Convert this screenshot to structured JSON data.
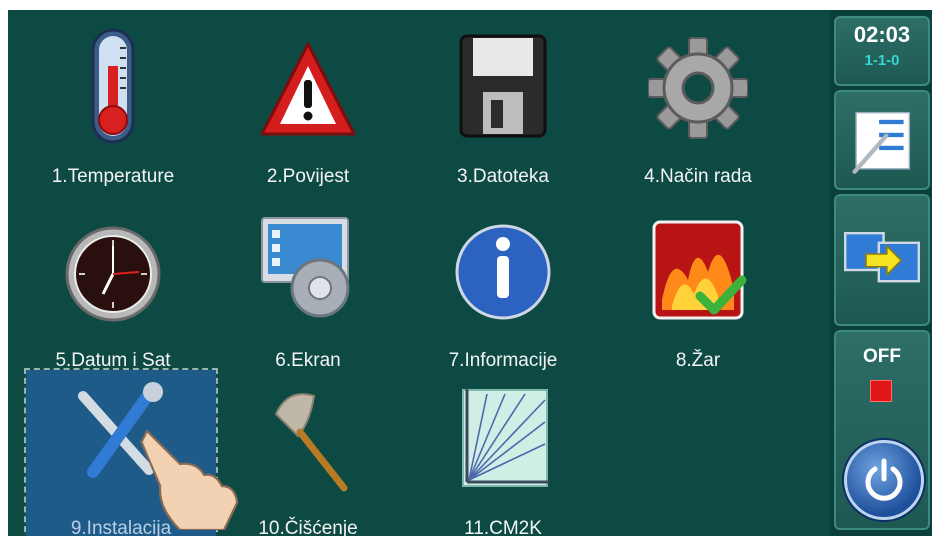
{
  "menu": {
    "items": [
      {
        "label": "1.Temperature",
        "icon": "thermometer-icon"
      },
      {
        "label": "2.Povijest",
        "icon": "warning-icon"
      },
      {
        "label": "3.Datoteka",
        "icon": "floppy-disk-icon"
      },
      {
        "label": "4.Način rada",
        "icon": "gear-icon"
      },
      {
        "label": "5.Datum i Sat",
        "icon": "clock-icon"
      },
      {
        "label": "6.Ekran",
        "icon": "monitor-gear-icon"
      },
      {
        "label": "7.Informacije",
        "icon": "info-icon"
      },
      {
        "label": "8.Žar",
        "icon": "embers-check-icon"
      },
      {
        "label": "9.Instalacija",
        "icon": "tools-icon",
        "selected": true
      },
      {
        "label": "10.Čišćenje",
        "icon": "duster-icon"
      },
      {
        "label": "11.CM2K",
        "icon": "graph-icon"
      }
    ]
  },
  "sidebar": {
    "time": "02:03",
    "date": "1-1-0",
    "status": "OFF",
    "status_color": "#e21818",
    "settings_icon": "pen-form-icon",
    "switch_icon": "screen-switch-icon",
    "power_icon": "power-icon"
  },
  "colors": {
    "background": "#0e4a44",
    "label_text": "#f4f4f4",
    "date_text": "#34d6d6"
  }
}
